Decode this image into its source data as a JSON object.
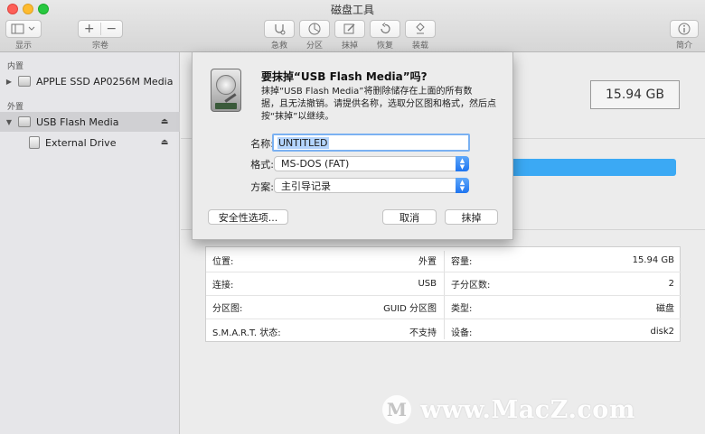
{
  "window": {
    "title": "磁盘工具"
  },
  "toolbar": {
    "view_label": "显示",
    "volume_label": "宗卷",
    "add_symbol": "+",
    "remove_symbol": "−",
    "first_aid_label": "急救",
    "partition_label": "分区",
    "erase_label": "抹掉",
    "restore_label": "恢复",
    "mount_label": "装载",
    "info_label": "简介"
  },
  "sidebar": {
    "internal_header": "内置",
    "external_header": "外置",
    "items": [
      {
        "label": "APPLE SSD AP0256M Media"
      },
      {
        "label": "USB Flash Media"
      },
      {
        "label": "External Drive"
      }
    ]
  },
  "main": {
    "capacity": "15.94 GB",
    "info": {
      "left": [
        {
          "label": "位置:",
          "value": "外置"
        },
        {
          "label": "连接:",
          "value": "USB"
        },
        {
          "label": "分区图:",
          "value": "GUID 分区图"
        },
        {
          "label": "S.M.A.R.T. 状态:",
          "value": "不支持"
        }
      ],
      "right": [
        {
          "label": "容量:",
          "value": "15.94 GB"
        },
        {
          "label": "子分区数:",
          "value": "2"
        },
        {
          "label": "类型:",
          "value": "磁盘"
        },
        {
          "label": "设备:",
          "value": "disk2"
        }
      ]
    }
  },
  "dialog": {
    "title": "要抹掉“USB Flash Media”吗?",
    "body_line1": "抹掉“USB Flash Media”将删除储存在上面的所有数",
    "body_line2": "据，且无法撤销。请提供名称，选取分区图和格式，然后点",
    "body_line3": "按“抹掉”以继续。",
    "name_label": "名称:",
    "name_value": "UNTITLED",
    "format_label": "格式:",
    "format_value": "MS-DOS (FAT)",
    "scheme_label": "方案:",
    "scheme_value": "主引导记录",
    "security_button": "安全性选项...",
    "cancel_button": "取消",
    "erase_button": "抹掉"
  },
  "watermark": {
    "text": "www.MacZ.com",
    "logo_letter": "M"
  },
  "colors": {
    "accent": "#3ba9f4",
    "selection": "#b3d4fd",
    "stepper": "#1e74f0"
  }
}
